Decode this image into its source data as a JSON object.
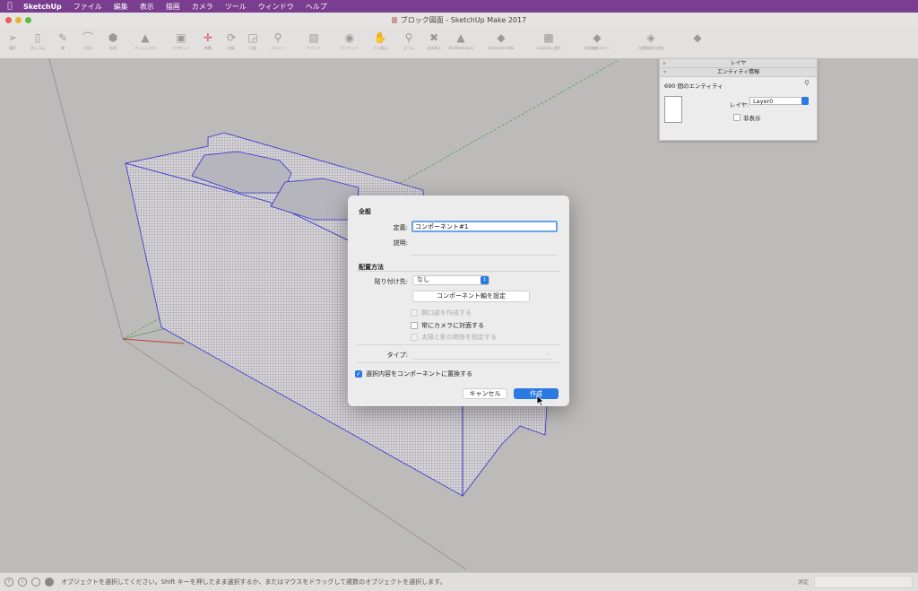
{
  "menubar": {
    "app": "SketchUp",
    "items": [
      "ファイル",
      "編集",
      "表示",
      "描画",
      "カメラ",
      "ツール",
      "ウィンドウ",
      "ヘルプ"
    ]
  },
  "window": {
    "title": "ブロック図面 - SketchUp Make 2017"
  },
  "toolbar": {
    "tools": [
      {
        "icon": "select-arrow-icon",
        "label": "選択"
      },
      {
        "icon": "eraser-icon",
        "label": "消しゴム"
      },
      {
        "icon": "pencil-icon",
        "label": "線"
      },
      {
        "icon": "arc-icon",
        "label": "円弧"
      },
      {
        "icon": "shapes-icon",
        "label": "形状"
      },
      {
        "icon": "push-pull-icon",
        "label": "プッシュ/プル"
      },
      {
        "icon": "offset-icon",
        "label": "オフセット"
      },
      {
        "icon": "move-icon",
        "label": "移動"
      },
      {
        "icon": "rotate-icon",
        "label": "回転"
      },
      {
        "icon": "scale-icon",
        "label": "尺度"
      },
      {
        "icon": "tape-measure-icon",
        "label": "メジャー"
      },
      {
        "icon": "paint-bucket-icon",
        "label": "ペイント"
      },
      {
        "icon": "orbit-icon",
        "label": "オービット"
      },
      {
        "icon": "pan-icon",
        "label": "パン表示"
      },
      {
        "icon": "zoom-icon",
        "label": "ズーム"
      },
      {
        "icon": "zoom-extents-icon",
        "label": "全体表示"
      },
      {
        "icon": "warehouse-icon",
        "label": "3D Warehouse"
      },
      {
        "icon": "extension-icon",
        "label": "Extension Warehouse"
      },
      {
        "icon": "layout-icon",
        "label": "LayOutに送信"
      },
      {
        "icon": "extension-manager-icon",
        "label": "拡張機能マネージャ"
      },
      {
        "icon": "add-location-icon",
        "label": "位置情報を追加"
      }
    ]
  },
  "inspector": {
    "panel_title": "レイヤ",
    "entity_title": "エンティティ情報",
    "count": "690 個のエンティティ",
    "layer_label": "レイヤ:",
    "layer_value": "Layer0",
    "hidden_label": "非表示"
  },
  "dialog": {
    "general_heading": "全般",
    "definition_label": "定義:",
    "definition_value": "コンポーネント#1",
    "description_label": "説明:",
    "placement_heading": "配置方法",
    "glue_label": "貼り付け先:",
    "glue_value": "なし",
    "set_axes_label": "コンポーネント軸を設定",
    "cut_opening_label": "開口部を作成する",
    "always_face_camera_label": "常にカメラに対面する",
    "shadows_face_sun_label": "太陽と影の関係を指定する",
    "type_label": "タイプ:",
    "replace_label": "選択内容をコンポーネントに置換する",
    "cancel_label": "キャンセル",
    "create_label": "作成"
  },
  "statusbar": {
    "message": "オブジェクトを選択してください。Shift キーを押したまま選択するか、またはマウスをドラッグして複数のオブジェクトを選択します。",
    "measure_label": "測定"
  }
}
